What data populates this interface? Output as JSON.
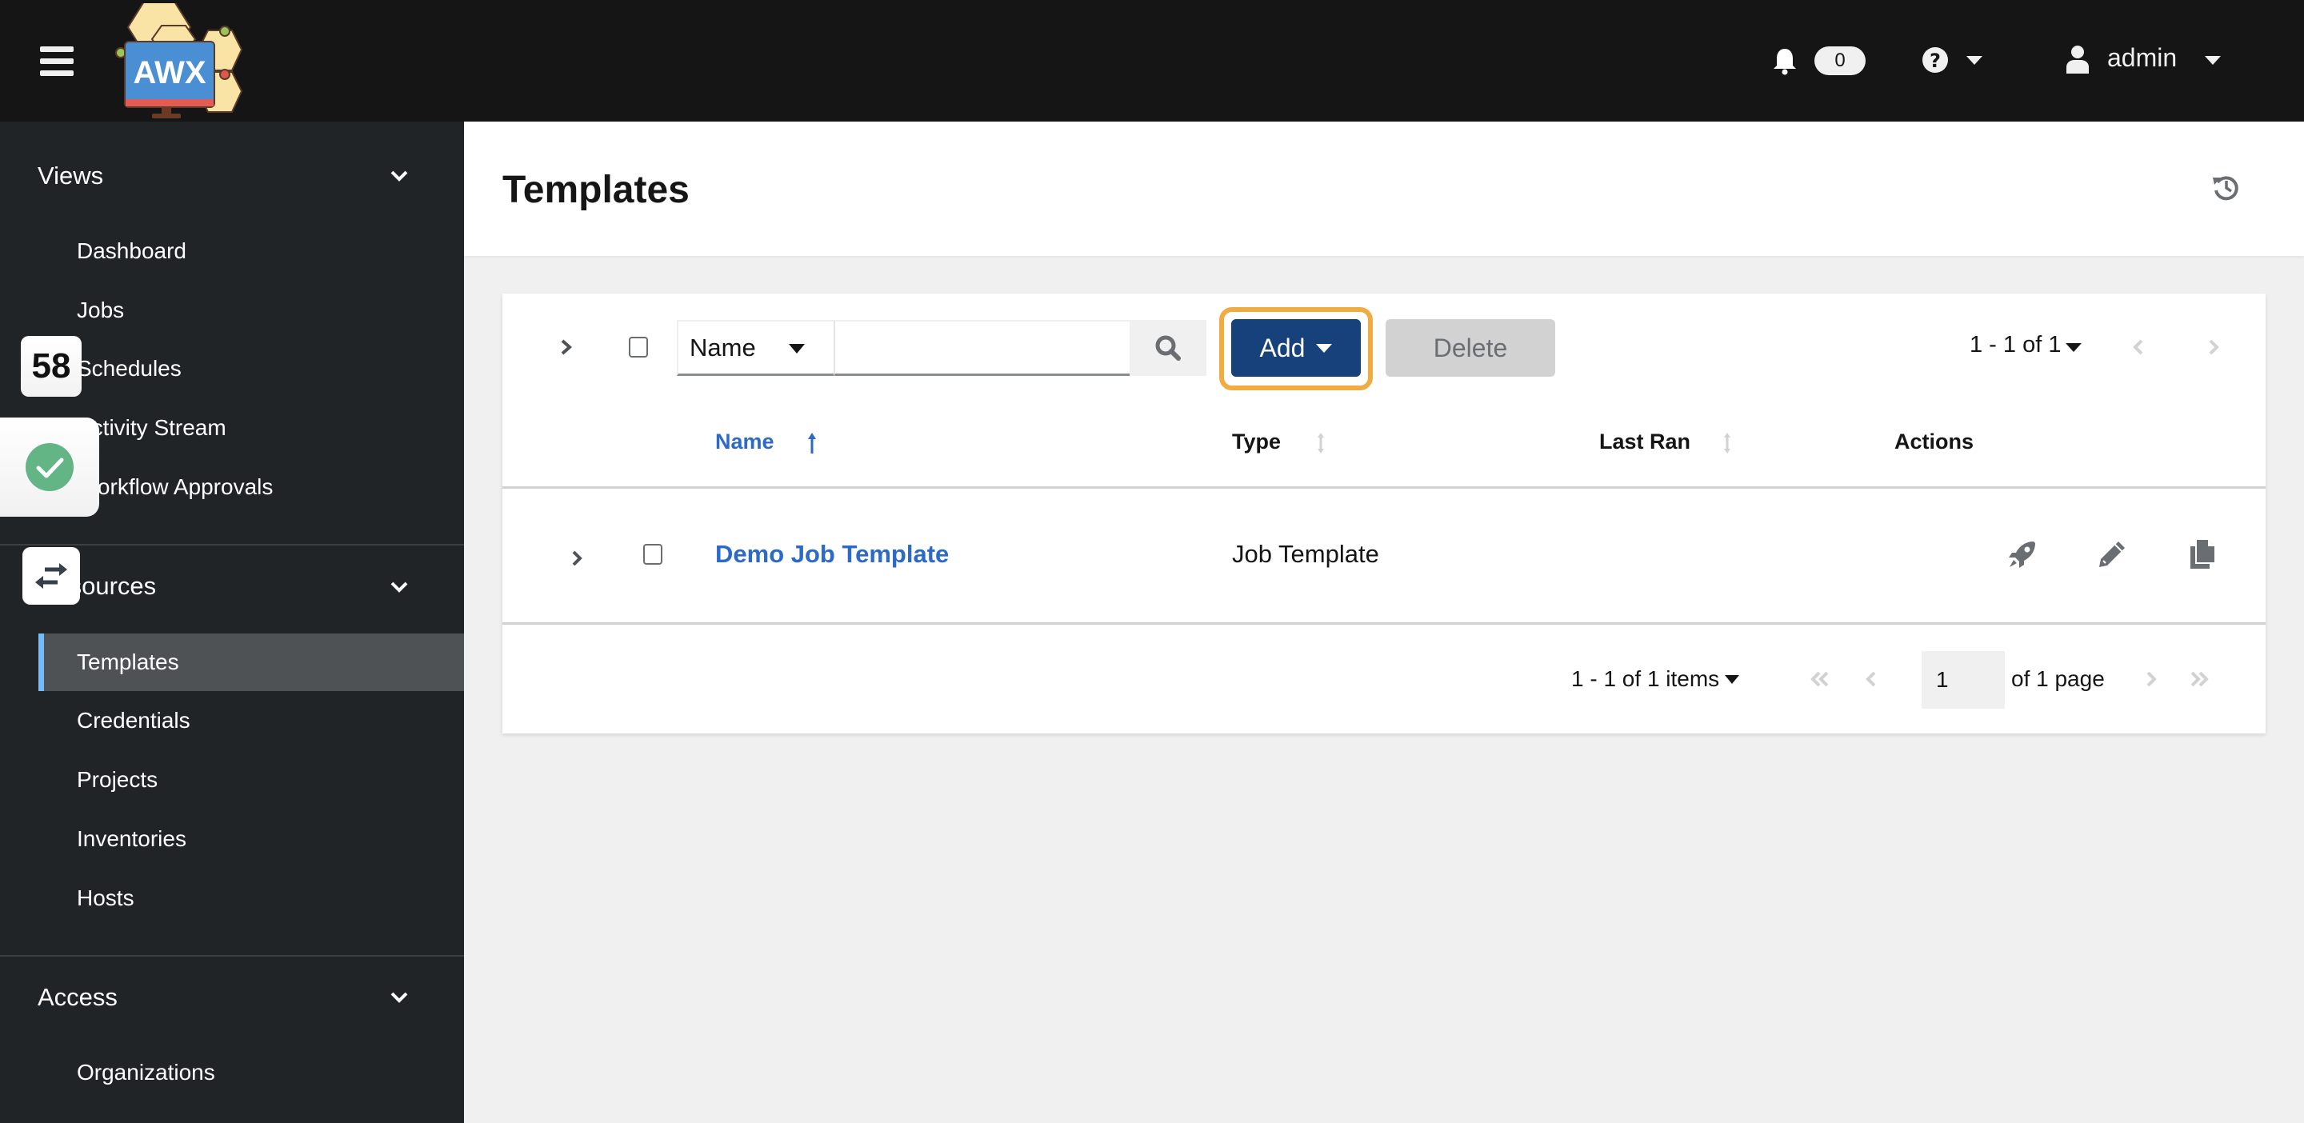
{
  "header": {
    "logo_text": "AWX",
    "notifications_count": "0",
    "user_name": "admin"
  },
  "sidebar": {
    "groups": [
      {
        "title": "Views",
        "items": [
          {
            "label": "Dashboard"
          },
          {
            "label": "Jobs"
          },
          {
            "label": "Schedules"
          },
          {
            "label": "Activity Stream"
          },
          {
            "label": "Workflow Approvals"
          }
        ]
      },
      {
        "title": "Resources",
        "items": [
          {
            "label": "Templates",
            "active": true
          },
          {
            "label": "Credentials"
          },
          {
            "label": "Projects"
          },
          {
            "label": "Inventories"
          },
          {
            "label": "Hosts"
          }
        ]
      },
      {
        "title": "Access",
        "items": [
          {
            "label": "Organizations"
          }
        ]
      }
    ]
  },
  "overlays": {
    "counter_badge": "58"
  },
  "page": {
    "title": "Templates"
  },
  "toolbar": {
    "filter_field": "Name",
    "search_value": "",
    "search_placeholder": "",
    "add_label": "Add",
    "delete_label": "Delete",
    "pagination_summary": "1 - 1 of 1"
  },
  "table": {
    "columns": [
      {
        "label": "Name",
        "sorted": "ascending"
      },
      {
        "label": "Type",
        "sortable": true
      },
      {
        "label": "Last Ran",
        "sortable": true
      },
      {
        "label": "Actions"
      }
    ],
    "rows": [
      {
        "name": "Demo Job Template",
        "type": "Job Template",
        "last_ran": ""
      }
    ]
  },
  "pagination": {
    "items_summary": "1 - 1 of 1 items",
    "current_page": "1",
    "of_pages": "of 1 page"
  },
  "colors": {
    "header_bg": "#151515",
    "sidebar_bg": "#212427",
    "active_nav_bg": "#4f5255",
    "active_nav_accent": "#73bcf7",
    "primary": "#16417a",
    "link": "#2b6ac9",
    "focus_ring": "#f0ab41",
    "success": "#63b585"
  }
}
